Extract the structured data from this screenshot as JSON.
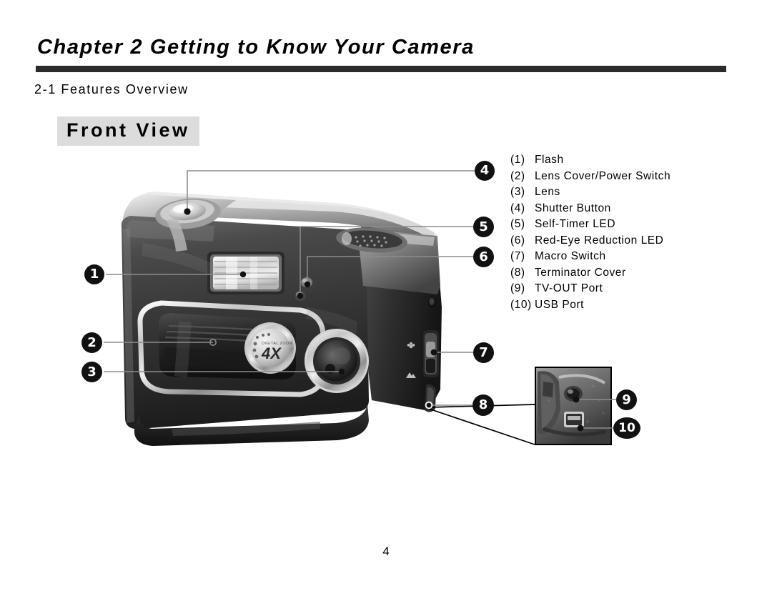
{
  "document": {
    "chapter_title": "Chapter 2 Getting to Know Your Camera",
    "section_title": "2-1 Features Overview",
    "view_heading": "Front View",
    "page_number": "4"
  },
  "legend": {
    "items": [
      {
        "num": "(1)",
        "label": "Flash"
      },
      {
        "num": "(2)",
        "label": "Lens Cover/Power Switch"
      },
      {
        "num": "(3)",
        "label": "Lens"
      },
      {
        "num": "(4)",
        "label": "Shutter Button"
      },
      {
        "num": "(5)",
        "label": "Self-Timer LED"
      },
      {
        "num": "(6)",
        "label": "Red-Eye Reduction LED"
      },
      {
        "num": "(7)",
        "label": "Macro Switch"
      },
      {
        "num": "(8)",
        "label": "Terminator Cover"
      },
      {
        "num": "(9)",
        "label": "TV-OUT Port"
      },
      {
        "num": "(10)",
        "label": "USB Port"
      }
    ]
  },
  "callouts": {
    "c1": "1",
    "c2": "2",
    "c3": "3",
    "c4": "4",
    "c5": "5",
    "c6": "6",
    "c7": "7",
    "c8": "8",
    "c9": "9",
    "c10": "10"
  },
  "figure": {
    "lens_dial_brand": "DIGITAL ZOOM",
    "lens_dial_zoom": "4X"
  },
  "colors": {
    "rule": "#2b2b2b",
    "heading_background": "#dcdcdc",
    "callout_fill": "#111111",
    "callout_text": "#ffffff",
    "leader_line": "#8c8c8c",
    "zoom_line": "#000000",
    "page_background": "#ffffff"
  }
}
